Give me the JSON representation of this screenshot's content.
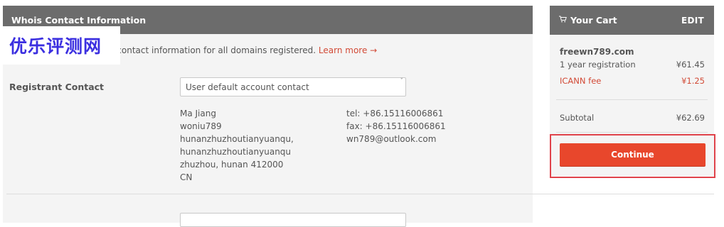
{
  "whois": {
    "header": "Whois Contact Information",
    "intro_text": "atabase to store owners' contact information for all domains registered.",
    "learn_more": "Learn more →",
    "watermark": "优乐评测网",
    "registrant_label": "Registrant Contact",
    "select_value": "User default account contact",
    "address_lines": [
      "Ma Jiang",
      "woniu789",
      "hunanzhuzhoutianyuanqu,",
      "hunanzhuzhoutianyuanqu",
      "zhuzhou, hunan 412000",
      "CN"
    ],
    "contact_lines": [
      "tel: +86.15116006861",
      "fax: +86.15116006861",
      "wn789@outlook.com"
    ]
  },
  "cart": {
    "title": "Your Cart",
    "edit": "EDIT",
    "domain": "freewn789.com",
    "items": [
      {
        "label": "1 year registration",
        "price": "¥61.45"
      },
      {
        "label": "ICANN fee",
        "price": "¥1.25"
      }
    ],
    "subtotal_label": "Subtotal",
    "subtotal_value": "¥62.69",
    "continue_label": "Continue"
  },
  "colors": {
    "header_bg": "#6c6c6c",
    "panel_bg": "#f4f4f4",
    "accent": "#e8472c",
    "link": "#d24a36",
    "highlight": "#e0434b",
    "watermark": "#3b2fe0"
  }
}
